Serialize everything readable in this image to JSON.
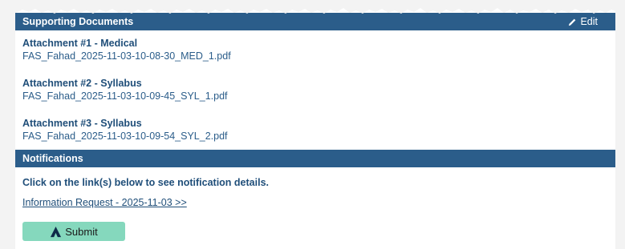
{
  "supporting_documents": {
    "title": "Supporting Documents",
    "edit_label": "Edit",
    "attachments": [
      {
        "title": "Attachment #1 - Medical",
        "filename": "FAS_Fahad_2025-11-03-10-08-30_MED_1.pdf"
      },
      {
        "title": "Attachment #2 - Syllabus",
        "filename": "FAS_Fahad_2025-11-03-10-09-45_SYL_1.pdf"
      },
      {
        "title": "Attachment #3 - Syllabus",
        "filename": "FAS_Fahad_2025-11-03-10-09-54_SYL_2.pdf"
      }
    ]
  },
  "notifications": {
    "title": "Notifications",
    "intro": "Click on the link(s) below to see notification details.",
    "link_label": "Information Request - 2025-11-03 >>"
  },
  "submit": {
    "label": "Submit",
    "icon": "submit-logo-icon"
  },
  "colors": {
    "header_bg": "#2b5d8a",
    "text": "#1f4e79",
    "submit_bg": "#85d8bd"
  }
}
